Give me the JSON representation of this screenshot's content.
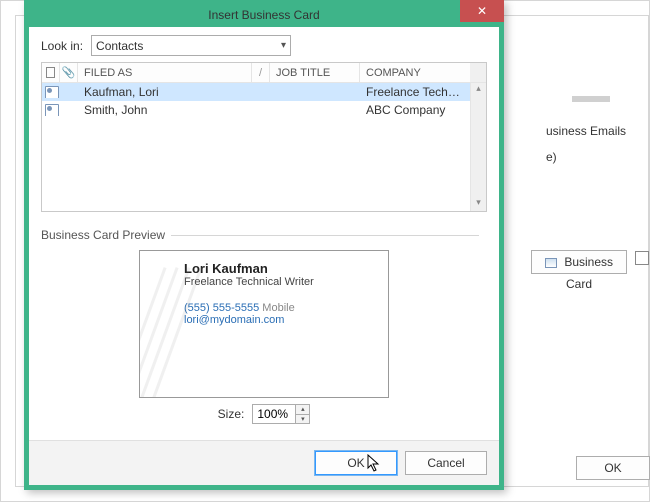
{
  "dialog": {
    "title": "Insert Business Card",
    "lookin_label": "Look in:",
    "lookin_value": "Contacts",
    "columns": {
      "filed_as": "FILED AS",
      "job_title": "JOB TITLE",
      "company": "COMPANY"
    },
    "rows": [
      {
        "filed_as": "Kaufman, Lori",
        "job_title": "",
        "company": "Freelance Techn...",
        "selected": true
      },
      {
        "filed_as": "Smith, John",
        "job_title": "",
        "company": "ABC Company",
        "selected": false
      }
    ],
    "preview_label": "Business Card Preview",
    "card": {
      "name": "Lori Kaufman",
      "title": "Freelance Technical Writer",
      "phone": "(555) 555-5555",
      "phone_type": "Mobile",
      "email": "lori@mydomain.com"
    },
    "size_label": "Size:",
    "size_value": "100%",
    "ok": "OK",
    "cancel": "Cancel"
  },
  "background": {
    "item1": "usiness Emails",
    "item2": "e)",
    "business_card_btn": "Business Card",
    "ok": "OK"
  }
}
